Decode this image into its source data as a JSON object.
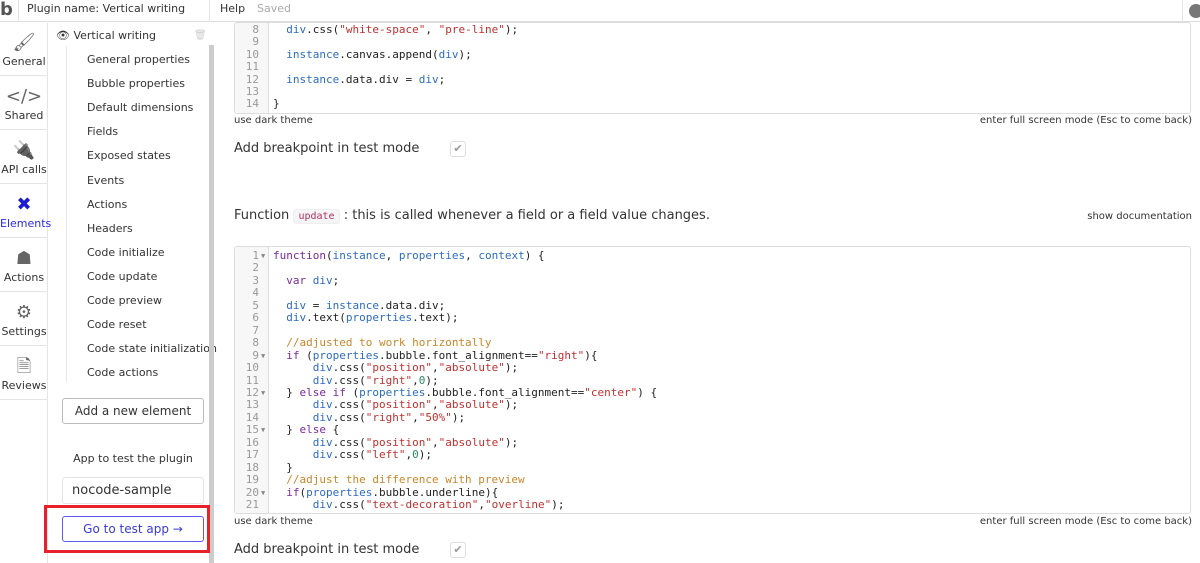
{
  "topbar": {
    "plugin_name": "Plugin name: Vertical writing",
    "help": "Help",
    "saved": "Saved"
  },
  "rail": [
    {
      "label": "General",
      "icon": "brush-icon",
      "glyph": "🖌"
    },
    {
      "label": "Shared",
      "icon": "code-icon",
      "glyph": "</>"
    },
    {
      "label": "API calls",
      "icon": "plug-icon",
      "glyph": "🔌"
    },
    {
      "label": "Elements",
      "icon": "elements-icon",
      "glyph": "✖",
      "active": true
    },
    {
      "label": "Actions",
      "icon": "workflow-icon",
      "glyph": "☗"
    },
    {
      "label": "Settings",
      "icon": "gear-icon",
      "glyph": "⚙"
    },
    {
      "label": "Reviews",
      "icon": "document-icon",
      "glyph": "🗎"
    }
  ],
  "panel": {
    "element_name": "Vertical writing",
    "items": [
      "General properties",
      "Bubble properties",
      "Default dimensions",
      "Fields",
      "Exposed states",
      "Events",
      "Actions",
      "Headers",
      "Code initialize",
      "Code update",
      "Code preview",
      "Code reset",
      "Code state initialization",
      "Code actions"
    ],
    "add_element": "Add a new element",
    "app_label": "App to test the plugin",
    "app_value": "nocode-sample",
    "go_test": "Go to test app →"
  },
  "editor1": {
    "lines": [
      {
        "n": "8",
        "t": [
          [
            "  ",
            "pl"
          ],
          [
            "div",
            "var"
          ],
          [
            ".css(",
            "pl"
          ],
          [
            "\"white-space\"",
            "str"
          ],
          [
            ", ",
            "pl"
          ],
          [
            "\"pre-line\"",
            "str"
          ],
          [
            ");",
            "pl"
          ]
        ]
      },
      {
        "n": "9",
        "t": []
      },
      {
        "n": "10",
        "t": [
          [
            "  ",
            "pl"
          ],
          [
            "instance",
            "var"
          ],
          [
            ".canvas.append(",
            "pl"
          ],
          [
            "div",
            "var"
          ],
          [
            ");",
            "pl"
          ]
        ]
      },
      {
        "n": "11",
        "t": []
      },
      {
        "n": "12",
        "t": [
          [
            "  ",
            "pl"
          ],
          [
            "instance",
            "var"
          ],
          [
            ".data.div = ",
            "pl"
          ],
          [
            "div",
            "var"
          ],
          [
            ";",
            "pl"
          ]
        ]
      },
      {
        "n": "13",
        "t": []
      },
      {
        "n": "14",
        "t": [
          [
            "}",
            "pl"
          ]
        ]
      }
    ],
    "dark_theme": "use dark theme",
    "fullscreen": "enter full screen mode (Esc to come back)",
    "breakpoint": "Add breakpoint in test mode",
    "breakpoint_checked": true
  },
  "function_desc": {
    "prefix": "Function",
    "code": "update",
    "suffix": ": this is called whenever a field or a field value changes.",
    "show_doc": "show documentation"
  },
  "editor2": {
    "lines": [
      {
        "n": "1",
        "f": true,
        "t": [
          [
            "function",
            "kw"
          ],
          [
            "(",
            "pl"
          ],
          [
            "instance",
            "var"
          ],
          [
            ", ",
            "pl"
          ],
          [
            "properties",
            "var"
          ],
          [
            ", ",
            "pl"
          ],
          [
            "context",
            "var"
          ],
          [
            ") {",
            "pl"
          ]
        ]
      },
      {
        "n": "2",
        "t": []
      },
      {
        "n": "3",
        "t": [
          [
            "  ",
            "pl"
          ],
          [
            "var",
            "kw"
          ],
          [
            " ",
            "pl"
          ],
          [
            "div",
            "var"
          ],
          [
            ";",
            "pl"
          ]
        ]
      },
      {
        "n": "4",
        "t": []
      },
      {
        "n": "5",
        "t": [
          [
            "  ",
            "pl"
          ],
          [
            "div",
            "var"
          ],
          [
            " = ",
            "pl"
          ],
          [
            "instance",
            "var"
          ],
          [
            ".data.div;",
            "pl"
          ]
        ]
      },
      {
        "n": "6",
        "t": [
          [
            "  ",
            "pl"
          ],
          [
            "div",
            "var"
          ],
          [
            ".text(",
            "pl"
          ],
          [
            "properties",
            "var"
          ],
          [
            ".text);",
            "pl"
          ]
        ]
      },
      {
        "n": "7",
        "t": []
      },
      {
        "n": "8",
        "t": [
          [
            "  ",
            "pl"
          ],
          [
            "//adjusted to work horizontally",
            "com"
          ]
        ]
      },
      {
        "n": "9",
        "f": true,
        "t": [
          [
            "  ",
            "pl"
          ],
          [
            "if",
            "kw"
          ],
          [
            " (",
            "pl"
          ],
          [
            "properties",
            "var"
          ],
          [
            ".bubble.font_alignment==",
            "pl"
          ],
          [
            "\"right\"",
            "str"
          ],
          [
            "){",
            "pl"
          ]
        ]
      },
      {
        "n": "10",
        "t": [
          [
            "      ",
            "pl"
          ],
          [
            "div",
            "var"
          ],
          [
            ".css(",
            "pl"
          ],
          [
            "\"position\"",
            "str"
          ],
          [
            ",",
            "pl"
          ],
          [
            "\"absolute\"",
            "str"
          ],
          [
            ");",
            "pl"
          ]
        ]
      },
      {
        "n": "11",
        "t": [
          [
            "      ",
            "pl"
          ],
          [
            "div",
            "var"
          ],
          [
            ".css(",
            "pl"
          ],
          [
            "\"right\"",
            "str"
          ],
          [
            ",",
            "pl"
          ],
          [
            "0",
            "num"
          ],
          [
            ");",
            "pl"
          ]
        ]
      },
      {
        "n": "12",
        "f": true,
        "t": [
          [
            "  } ",
            "pl"
          ],
          [
            "else if",
            "kw"
          ],
          [
            " (",
            "pl"
          ],
          [
            "properties",
            "var"
          ],
          [
            ".bubble.font_alignment==",
            "pl"
          ],
          [
            "\"center\"",
            "str"
          ],
          [
            ") {",
            "pl"
          ]
        ]
      },
      {
        "n": "13",
        "t": [
          [
            "      ",
            "pl"
          ],
          [
            "div",
            "var"
          ],
          [
            ".css(",
            "pl"
          ],
          [
            "\"position\"",
            "str"
          ],
          [
            ",",
            "pl"
          ],
          [
            "\"absolute\"",
            "str"
          ],
          [
            ");",
            "pl"
          ]
        ]
      },
      {
        "n": "14",
        "t": [
          [
            "      ",
            "pl"
          ],
          [
            "div",
            "var"
          ],
          [
            ".css(",
            "pl"
          ],
          [
            "\"right\"",
            "str"
          ],
          [
            ",",
            "pl"
          ],
          [
            "\"50%\"",
            "str"
          ],
          [
            ");",
            "pl"
          ]
        ]
      },
      {
        "n": "15",
        "f": true,
        "t": [
          [
            "  } ",
            "pl"
          ],
          [
            "else",
            "kw"
          ],
          [
            " {",
            "pl"
          ]
        ]
      },
      {
        "n": "16",
        "t": [
          [
            "      ",
            "pl"
          ],
          [
            "div",
            "var"
          ],
          [
            ".css(",
            "pl"
          ],
          [
            "\"position\"",
            "str"
          ],
          [
            ",",
            "pl"
          ],
          [
            "\"absolute\"",
            "str"
          ],
          [
            ");",
            "pl"
          ]
        ]
      },
      {
        "n": "17",
        "t": [
          [
            "      ",
            "pl"
          ],
          [
            "div",
            "var"
          ],
          [
            ".css(",
            "pl"
          ],
          [
            "\"left\"",
            "str"
          ],
          [
            ",",
            "pl"
          ],
          [
            "0",
            "num"
          ],
          [
            ");",
            "pl"
          ]
        ]
      },
      {
        "n": "18",
        "t": [
          [
            "  }",
            "pl"
          ]
        ]
      },
      {
        "n": "19",
        "t": [
          [
            "  ",
            "pl"
          ],
          [
            "//adjust the difference with preview",
            "com"
          ]
        ]
      },
      {
        "n": "20",
        "f": true,
        "t": [
          [
            "  ",
            "pl"
          ],
          [
            "if",
            "kw"
          ],
          [
            "(",
            "pl"
          ],
          [
            "properties",
            "var"
          ],
          [
            ".bubble.underline){",
            "pl"
          ]
        ]
      },
      {
        "n": "21",
        "t": [
          [
            "      ",
            "pl"
          ],
          [
            "div",
            "var"
          ],
          [
            ".css(",
            "pl"
          ],
          [
            "\"text-decoration\"",
            "str"
          ],
          [
            ",",
            "pl"
          ],
          [
            "\"overline\"",
            "str"
          ],
          [
            ");",
            "pl"
          ]
        ]
      }
    ],
    "dark_theme": "use dark theme",
    "fullscreen": "enter full screen mode (Esc to come back)",
    "breakpoint": "Add breakpoint in test mode",
    "breakpoint_checked": true
  },
  "colors": {
    "accent": "#2a2ae0",
    "highlight_box": "#e8202a"
  }
}
